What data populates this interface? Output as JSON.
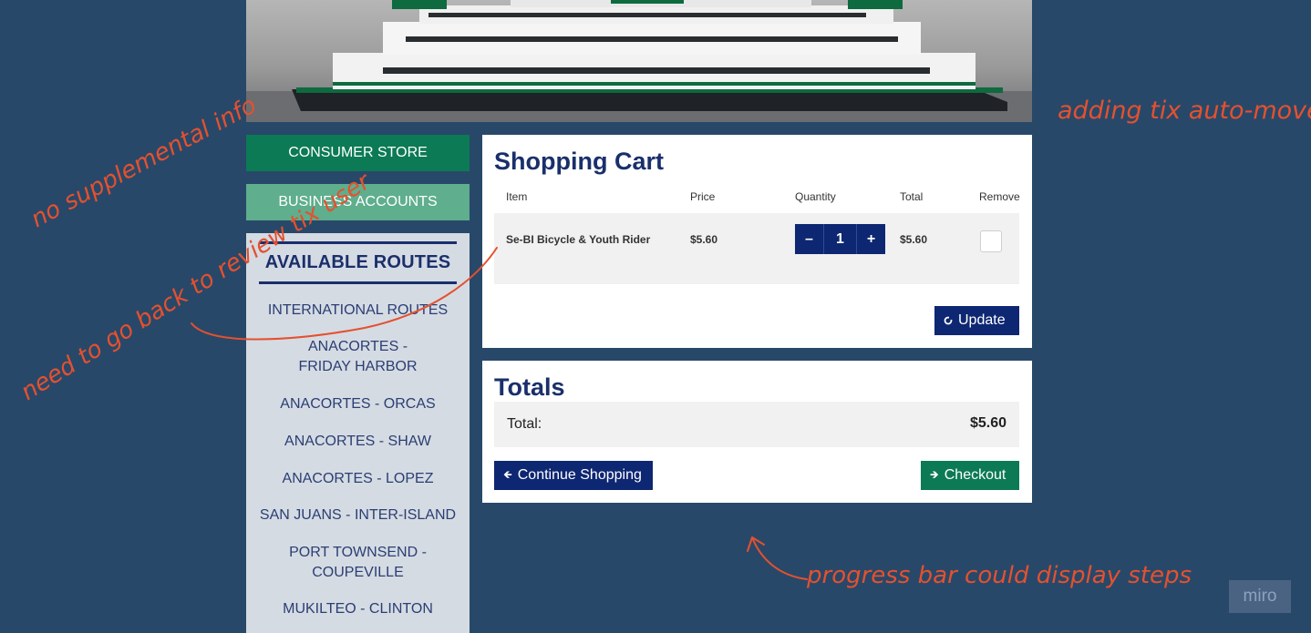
{
  "nav": {
    "consumer_store": "CONSUMER STORE",
    "business_accounts": "BUSINESS ACCOUNTS"
  },
  "routes": {
    "title": "AVAILABLE ROUTES",
    "items": [
      "INTERNATIONAL ROUTES",
      "ANACORTES - FRIDAY HARBOR",
      "ANACORTES - ORCAS",
      "ANACORTES - SHAW",
      "ANACORTES - LOPEZ",
      "SAN JUANS - INTER-ISLAND",
      "PORT TOWNSEND - COUPEVILLE",
      "MUKILTEO - CLINTON"
    ]
  },
  "cart": {
    "title": "Shopping Cart",
    "columns": {
      "item": "Item",
      "price": "Price",
      "quantity": "Quantity",
      "total": "Total",
      "remove": "Remove"
    },
    "rows": [
      {
        "item": "Se-BI Bicycle & Youth Rider",
        "price": "$5.60",
        "quantity": "1",
        "total": "$5.60"
      }
    ],
    "qty_minus": "–",
    "qty_plus": "+",
    "update_label": "Update"
  },
  "totals": {
    "title": "Totals",
    "label": "Total:",
    "value": "$5.60",
    "continue_label": "Continue Shopping",
    "checkout_label": "Checkout"
  },
  "annotations": {
    "color": "#e4512f",
    "no_supplemental": "no supplemental info",
    "adding_tix": "adding tix auto-moves user to cart",
    "need_to_go_back": "need to go back to review tix user",
    "progress_bar": "progress bar could display steps"
  },
  "watermark": "miro",
  "colors": {
    "background": "#284869",
    "navy": "#0e2772",
    "green": "#0c7a55",
    "light_green": "#5fae8d"
  }
}
